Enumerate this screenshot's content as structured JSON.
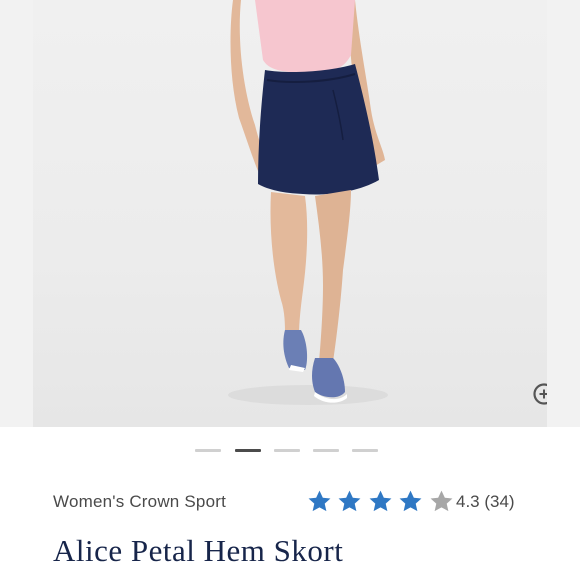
{
  "product": {
    "collection": "Women's Crown Sport",
    "title": "Alice Petal Hem Skort",
    "rating_value": 4.3,
    "rating_text": "4.3 (34)",
    "review_count": 34
  },
  "gallery": {
    "slide_count": 5,
    "active_index": 1,
    "zoom_icon": "zoom-in-icon"
  },
  "colors": {
    "star_filled": "#2f78c4",
    "star_empty": "#a7a7a7",
    "title": "#17254a",
    "skort": "#1e2a55",
    "top": "#f6c6cf"
  }
}
